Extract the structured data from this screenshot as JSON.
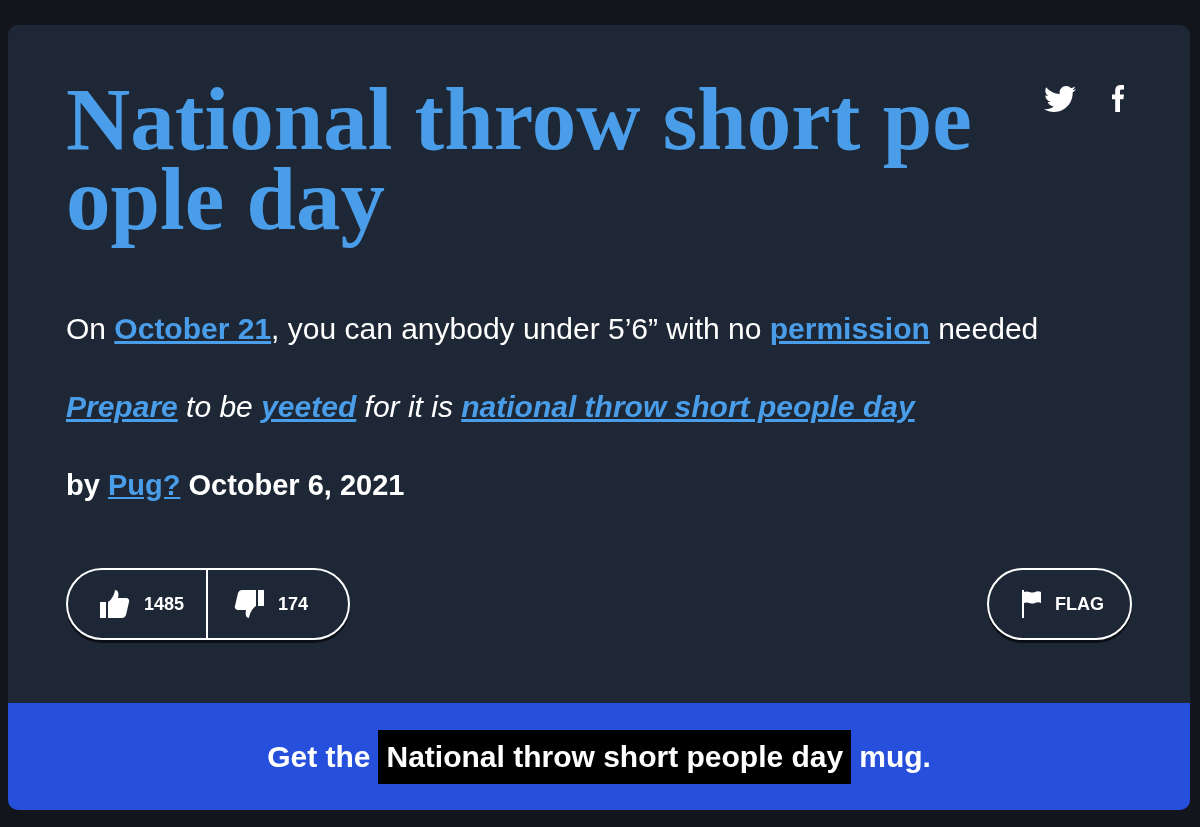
{
  "title": "National throw short people day",
  "meaning": [
    {
      "kind": "text",
      "text": "On "
    },
    {
      "kind": "link",
      "text": "October 21"
    },
    {
      "kind": "text",
      "text": ", you can anybody under 5’6” with no "
    },
    {
      "kind": "link",
      "text": "permission"
    },
    {
      "kind": "text",
      "text": " needed"
    }
  ],
  "example": [
    {
      "kind": "link",
      "text": "Prepare"
    },
    {
      "kind": "text",
      "text": " to be "
    },
    {
      "kind": "link",
      "text": "yeeted"
    },
    {
      "kind": "text",
      "text": " for it is "
    },
    {
      "kind": "link",
      "text": "national throw short people day"
    }
  ],
  "byline": [
    {
      "kind": "text",
      "text": "by "
    },
    {
      "kind": "link",
      "text": "Pug?"
    },
    {
      "kind": "text",
      "text": " October 6, 2021"
    }
  ],
  "votes": {
    "up": "1485",
    "down": "174"
  },
  "flag": "FLAG",
  "mug_banner": {
    "prefix": "Get the",
    "highlight": "National throw short people day",
    "suffix": "mug."
  }
}
